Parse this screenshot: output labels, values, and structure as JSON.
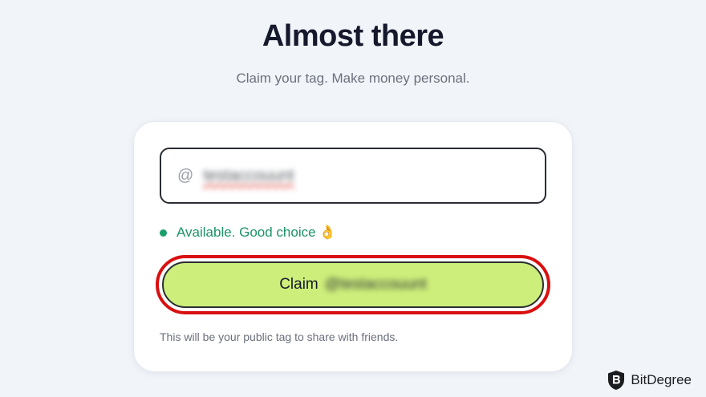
{
  "header": {
    "title": "Almost there",
    "subtitle": "Claim your tag. Make money personal."
  },
  "tag_input": {
    "prefix": "@",
    "value": "testaccouunt"
  },
  "status": {
    "text": "Available. Good choice",
    "emoji": "👌",
    "color": "#19a06a"
  },
  "claim_button": {
    "label": "Claim",
    "tag": "@testaccouunt",
    "color": "#cdee7a"
  },
  "hint": "This will be your public tag to share with friends.",
  "watermark": {
    "brand": "BitDegree",
    "icon": "bitdegree-shield-icon"
  },
  "colors": {
    "highlight": "#d90f10",
    "background": "#f1f4f9"
  }
}
